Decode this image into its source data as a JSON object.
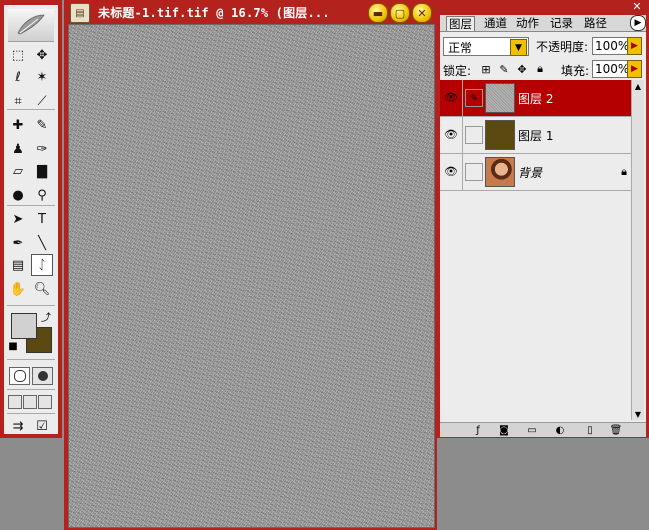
{
  "document": {
    "title": "未标题-1.tif.tif @ 16.7% (图层..."
  },
  "toolbox": {
    "tools": [
      {
        "icon": "marquee-icon",
        "glyph": "⬚"
      },
      {
        "icon": "move-icon",
        "glyph": "✥"
      },
      {
        "icon": "lasso-icon",
        "glyph": "ℓ"
      },
      {
        "icon": "magic-wand-icon",
        "glyph": "✶"
      },
      {
        "icon": "crop-icon",
        "glyph": "⌗"
      },
      {
        "icon": "slice-icon",
        "glyph": "⟋"
      },
      {
        "icon": "healing-brush-icon",
        "glyph": "✚"
      },
      {
        "icon": "brush-icon",
        "glyph": "✎"
      },
      {
        "icon": "clone-stamp-icon",
        "glyph": "♟"
      },
      {
        "icon": "history-brush-icon",
        "glyph": "✑"
      },
      {
        "icon": "eraser-icon",
        "glyph": "▱"
      },
      {
        "icon": "gradient-icon",
        "glyph": "▇"
      },
      {
        "icon": "blur-icon",
        "glyph": "●"
      },
      {
        "icon": "dodge-icon",
        "glyph": "⚲"
      },
      {
        "icon": "path-select-icon",
        "glyph": "➤"
      },
      {
        "icon": "type-icon",
        "glyph": "T"
      },
      {
        "icon": "pen-icon",
        "glyph": "✒"
      },
      {
        "icon": "line-icon",
        "glyph": "╲"
      },
      {
        "icon": "notes-icon",
        "glyph": "▤"
      },
      {
        "icon": "eyedropper-icon",
        "glyph": "ᛇ"
      },
      {
        "icon": "hand-icon",
        "glyph": "✋"
      },
      {
        "icon": "zoom-icon",
        "glyph": "🔍︎"
      }
    ],
    "foreground_color": "#d1d1d1",
    "background_color": "#5a4a12"
  },
  "panel": {
    "tabs": [
      "图层",
      "通道",
      "动作",
      "记录",
      "路径"
    ],
    "blend_mode": "正常",
    "opacity_label": "不透明度:",
    "opacity_value": "100%",
    "lock_label": "锁定:",
    "fill_label": "填充:",
    "fill_value": "100%",
    "layers": [
      {
        "name": "图层 2",
        "selected": true,
        "thumb": "noise",
        "locked": false
      },
      {
        "name": "图层 1",
        "selected": false,
        "thumb": "#5a4a12",
        "locked": false
      },
      {
        "name": "背景",
        "selected": false,
        "thumb": "photo",
        "locked": true
      }
    ]
  },
  "colors": {
    "window_frame": "#b3221d",
    "selection": "#b40000",
    "accent_yellow": "#f0c000"
  }
}
